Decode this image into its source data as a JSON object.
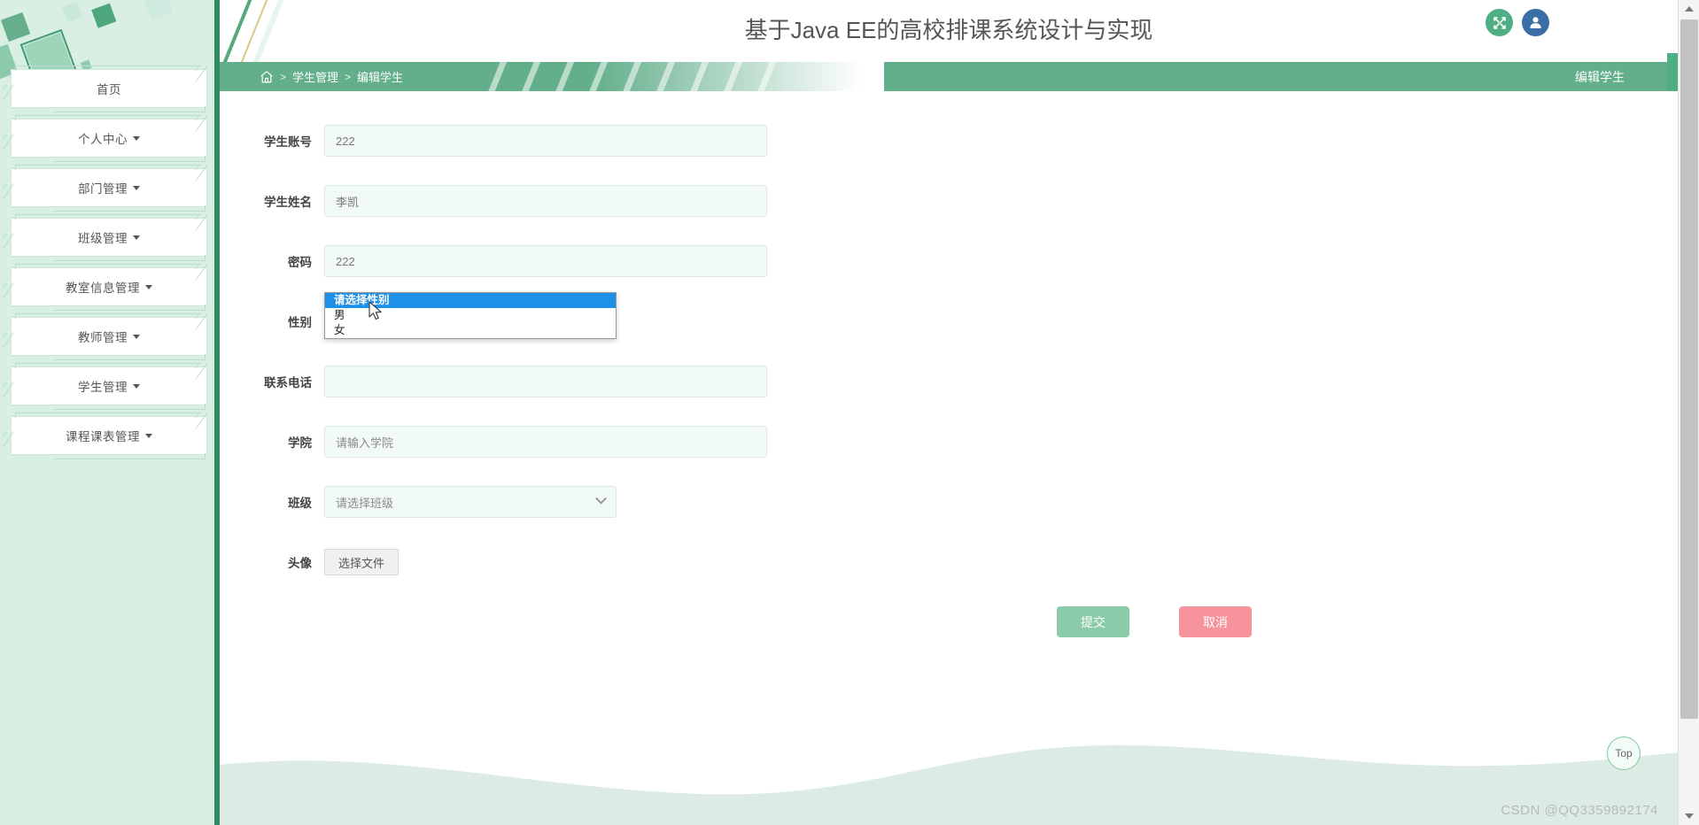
{
  "app": {
    "title": "基于Java EE的高校排课系统设计与实现",
    "right_tag": "编辑学生"
  },
  "topbar": {
    "fullscreen_icon": "fullscreen-expand-icon",
    "user_icon": "user-avatar-icon"
  },
  "breadcrumb": {
    "home_icon": "home-icon",
    "sep": ">",
    "items": [
      {
        "label": "学生管理"
      },
      {
        "label": "编辑学生"
      }
    ]
  },
  "sidebar": {
    "items": [
      {
        "label": "首页",
        "has_caret": false
      },
      {
        "label": "个人中心",
        "has_caret": true
      },
      {
        "label": "部门管理",
        "has_caret": true
      },
      {
        "label": "班级管理",
        "has_caret": true
      },
      {
        "label": "教室信息管理",
        "has_caret": true
      },
      {
        "label": "教师管理",
        "has_caret": true
      },
      {
        "label": "学生管理",
        "has_caret": true
      },
      {
        "label": "课程课表管理",
        "has_caret": true
      }
    ]
  },
  "form": {
    "fields": [
      {
        "label": "学生账号",
        "value": "222",
        "placeholder": "",
        "type": "text"
      },
      {
        "label": "学生姓名",
        "value": "李凯",
        "placeholder": "",
        "type": "text"
      },
      {
        "label": "密码",
        "value": "222",
        "placeholder": "",
        "type": "password"
      },
      {
        "label": "性别",
        "value": "请选择性别",
        "placeholder": "请选择性别",
        "type": "select"
      },
      {
        "label": "联系电话",
        "value": "",
        "placeholder": "",
        "type": "text"
      },
      {
        "label": "学院",
        "value": "请输入学院",
        "placeholder": "请输入学院",
        "type": "text"
      },
      {
        "label": "班级",
        "value": "请选择班级",
        "placeholder": "请选择班级",
        "type": "select"
      },
      {
        "label": "头像",
        "value": "选择文件",
        "placeholder": "",
        "type": "file"
      }
    ],
    "gender_dropdown": {
      "open": true,
      "options": [
        {
          "label": "请选择性别",
          "selected": true
        },
        {
          "label": "男",
          "selected": false
        },
        {
          "label": "女",
          "selected": false
        }
      ]
    },
    "buttons": {
      "submit": "提交",
      "cancel": "取消"
    }
  },
  "footer": {
    "top_button": "Top",
    "watermark": "CSDN @QQ3359892174"
  },
  "colors": {
    "brand_green": "#63af8b",
    "sidebar_bg": "#d9efe3",
    "submit": "#8ccbaa",
    "cancel": "#f7939c",
    "highlight_blue": "#1e90e8",
    "avatar_blue": "#3a6ea5"
  }
}
